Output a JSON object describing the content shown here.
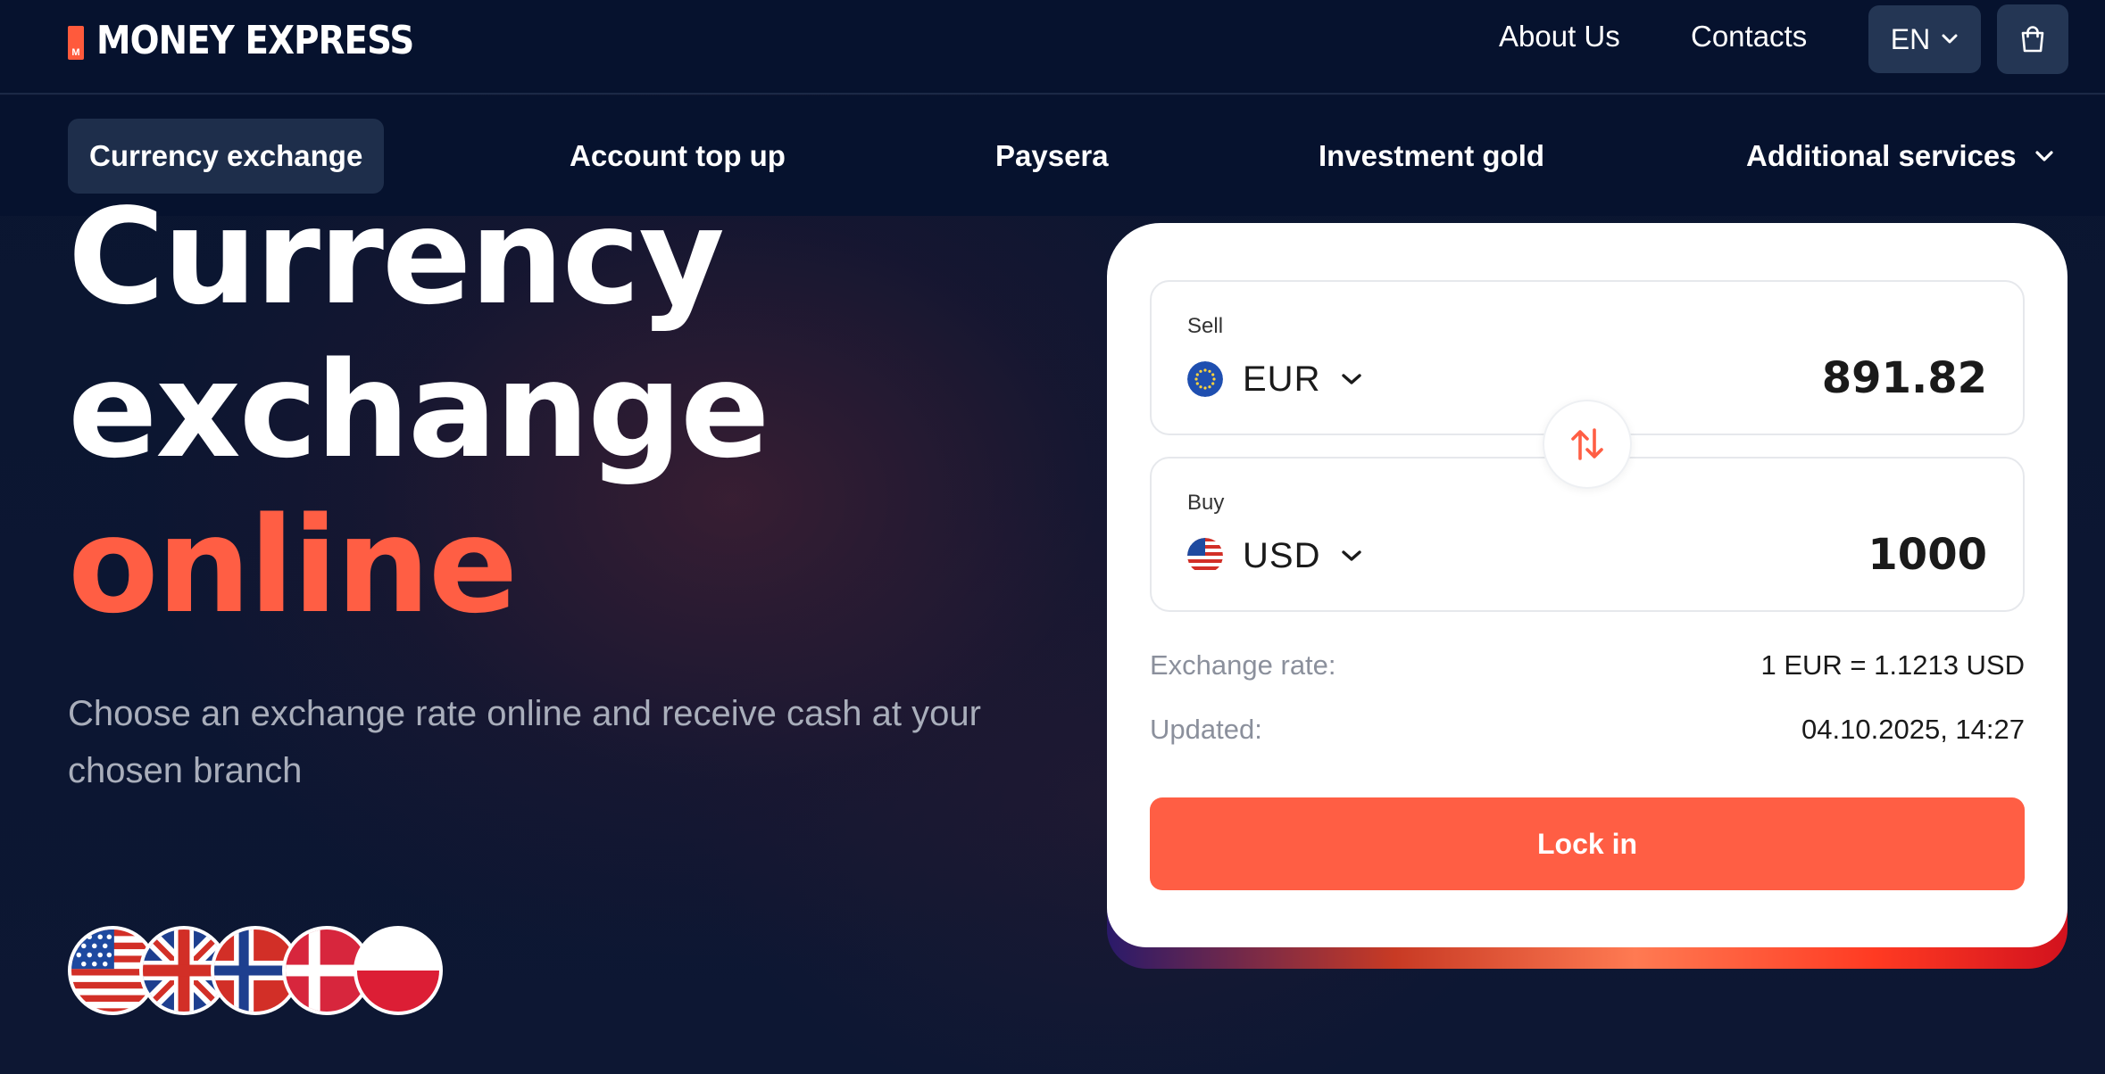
{
  "brand": {
    "mark": "M",
    "name": "MONEY EXPRESS"
  },
  "header": {
    "links": [
      "About Us",
      "Contacts"
    ],
    "language": "EN",
    "cart_icon": "cart-icon"
  },
  "nav": {
    "items": [
      "Currency exchange",
      "Account top up",
      "Paysera",
      "Investment gold",
      "Additional services"
    ],
    "active": "Currency exchange"
  },
  "hero": {
    "line1": "Currency",
    "line2": "exchange",
    "line3": "online",
    "subtitle": "Choose an exchange rate online and receive cash at your chosen branch",
    "flags": [
      "us-flag",
      "uk-flag",
      "norway-flag",
      "denmark-flag",
      "poland-flag"
    ]
  },
  "exchange": {
    "sell": {
      "label": "Sell",
      "currency": "EUR",
      "amount": "891.82"
    },
    "buy": {
      "label": "Buy",
      "currency": "USD",
      "amount": "1000"
    },
    "rate_label": "Exchange rate:",
    "rate_value": "1 EUR = 1.1213 USD",
    "updated_label": "Updated:",
    "updated_value": "04.10.2025, 14:27",
    "submit": "Lock in"
  },
  "colors": {
    "accent": "#ff5e44",
    "background": "#0a1530",
    "nav_active": "#1e2e4b",
    "widget": "#ffffff"
  }
}
